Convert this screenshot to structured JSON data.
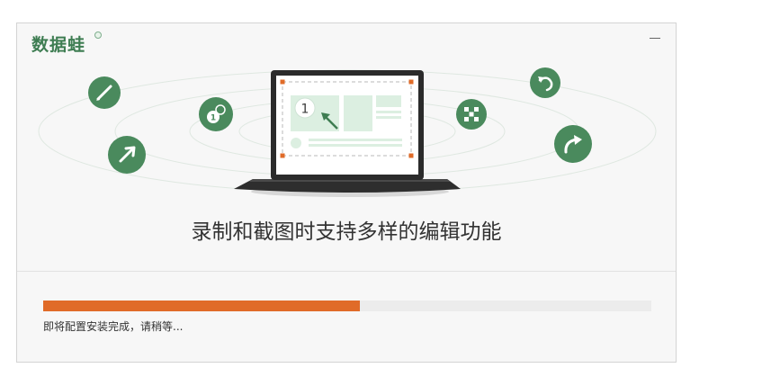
{
  "app": {
    "logo_text": "数据蛙",
    "minimize_label": "minimize"
  },
  "illustration": {
    "screen_number": "1",
    "tool_icons": [
      "pen-icon",
      "arrow-icon",
      "number-marker-icon",
      "mosaic-icon",
      "undo-icon",
      "redo-icon"
    ]
  },
  "headline": "录制和截图时支持多样的编辑功能",
  "progress": {
    "fraction": 0.52,
    "status": "即将配置安装完成，请稍等..."
  },
  "colors": {
    "brand_green": "#3e7d52",
    "progress_orange": "#e06b28",
    "track_gray": "#ececec"
  }
}
